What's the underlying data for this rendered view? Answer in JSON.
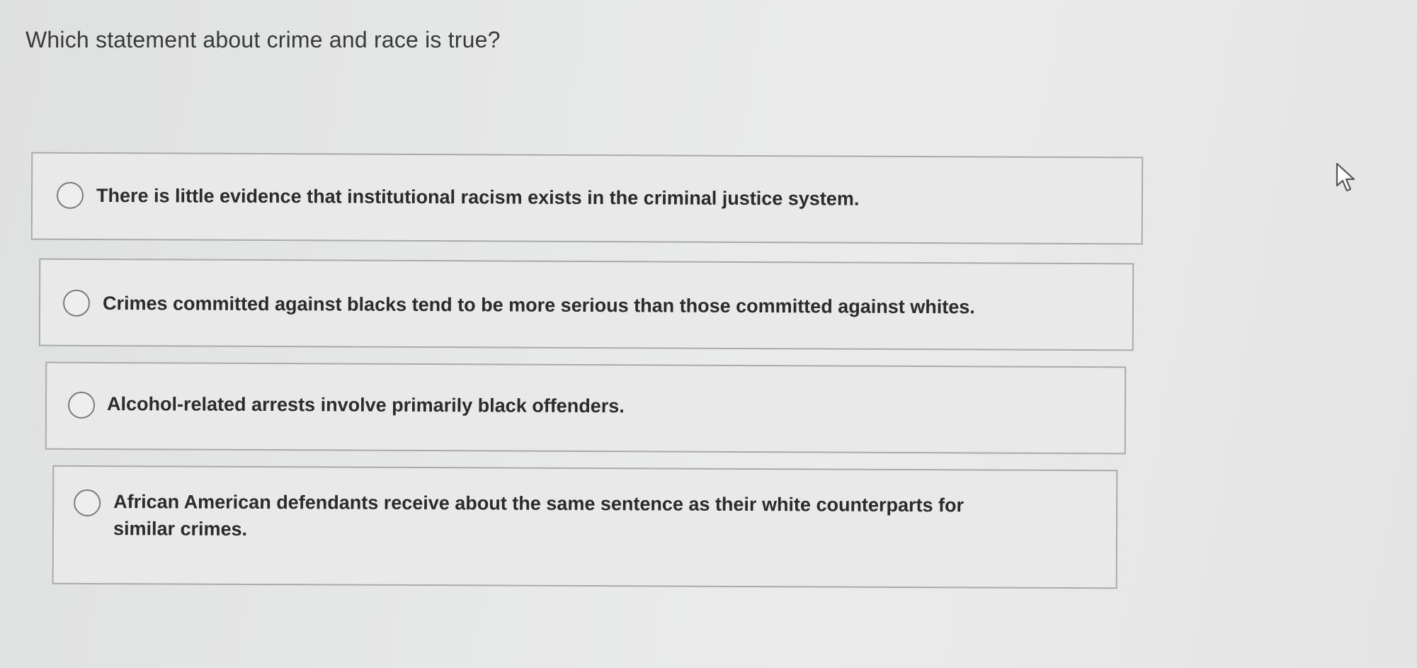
{
  "question": {
    "text": "Which statement about crime and race is true?"
  },
  "options": [
    {
      "label": "There is little evidence that institutional racism exists in the criminal justice system."
    },
    {
      "label": "Crimes committed against blacks tend to be more serious than those committed against whites."
    },
    {
      "label": "Alcohol-related arrests involve primarily black offenders."
    },
    {
      "label": "African American defendants receive about the same sentence as their white counterparts for",
      "label_line2": "similar crimes."
    }
  ],
  "icons": {
    "radio": "radio-unchecked-icon",
    "cursor": "mouse-pointer-icon"
  }
}
